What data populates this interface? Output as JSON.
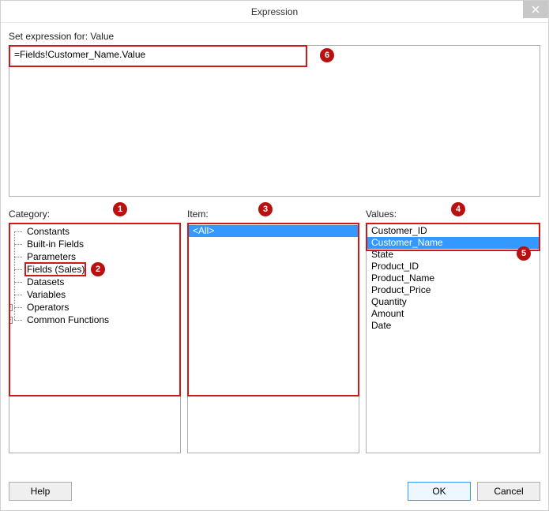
{
  "window": {
    "title": "Expression"
  },
  "header_label": "Set expression for: Value",
  "expression_text": "=Fields!Customer_Name.Value",
  "panels": {
    "category_label": "Category:",
    "item_label": "Item:",
    "values_label": "Values:"
  },
  "category_tree": [
    {
      "label": "Constants",
      "expandable": false
    },
    {
      "label": "Built-in Fields",
      "expandable": false
    },
    {
      "label": "Parameters",
      "expandable": false
    },
    {
      "label": "Fields (Sales)",
      "expandable": false
    },
    {
      "label": "Datasets",
      "expandable": false
    },
    {
      "label": "Variables",
      "expandable": false
    },
    {
      "label": "Operators",
      "expandable": true
    },
    {
      "label": "Common Functions",
      "expandable": true
    }
  ],
  "item_list": [
    {
      "label": "<All>",
      "selected": true
    }
  ],
  "values_list": [
    {
      "label": "Customer_ID",
      "selected": false
    },
    {
      "label": "Customer_Name",
      "selected": true
    },
    {
      "label": "State",
      "selected": false
    },
    {
      "label": "Product_ID",
      "selected": false
    },
    {
      "label": "Product_Name",
      "selected": false
    },
    {
      "label": "Product_Price",
      "selected": false
    },
    {
      "label": "Quantity",
      "selected": false
    },
    {
      "label": "Amount",
      "selected": false
    },
    {
      "label": "Date",
      "selected": false
    }
  ],
  "buttons": {
    "help": "Help",
    "ok": "OK",
    "cancel": "Cancel"
  },
  "annotations": {
    "n1": "1",
    "n2": "2",
    "n3": "3",
    "n4": "4",
    "n5": "5",
    "n6": "6"
  }
}
